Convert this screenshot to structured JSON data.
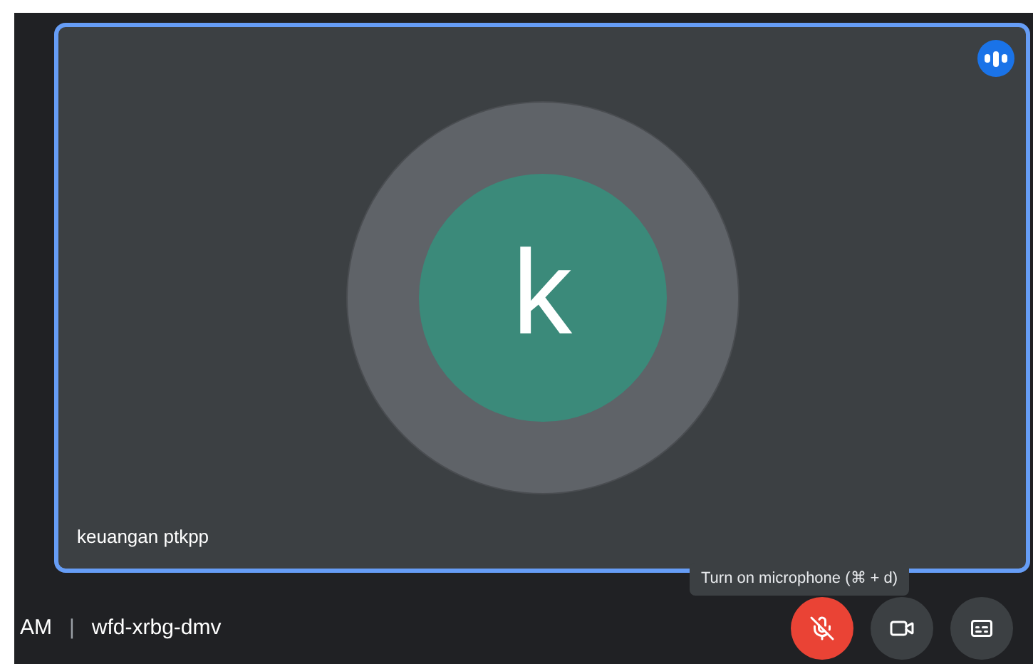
{
  "tile": {
    "participant_name": "keuangan ptkpp",
    "initial": "k",
    "speaking": true
  },
  "tooltip": "Turn on microphone (⌘ + d)",
  "meeting": {
    "time": "AM",
    "separator": "|",
    "code": "wfd-xrbg-dmv"
  },
  "controls": [
    {
      "kind": "mic",
      "on": false
    },
    {
      "kind": "camera",
      "on": true
    },
    {
      "kind": "captions",
      "on": false
    }
  ]
}
